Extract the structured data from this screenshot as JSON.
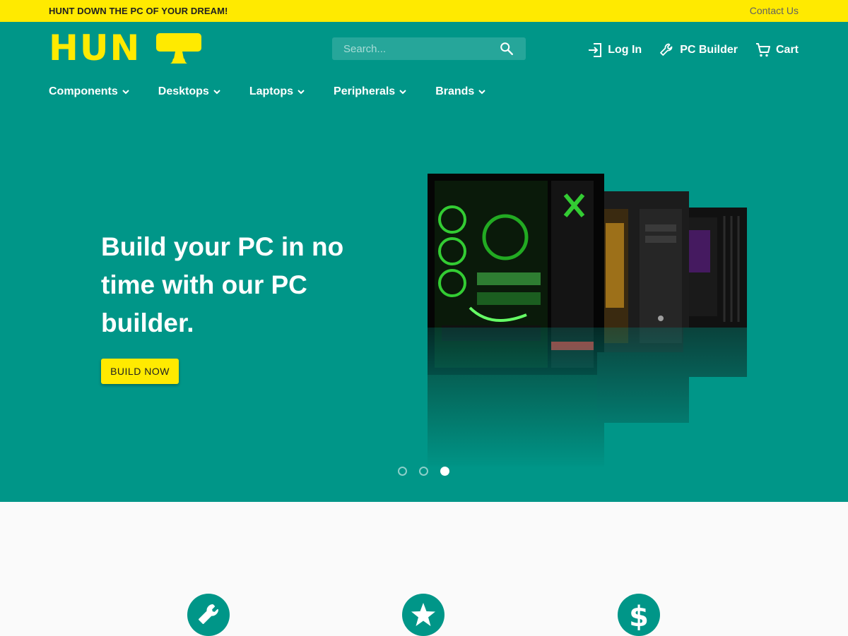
{
  "topbar": {
    "tagline": "HUNT DOWN THE PC OF YOUR DREAM!",
    "contact_label": "Contact Us"
  },
  "logo": {
    "text": "HUN"
  },
  "search": {
    "placeholder": "Search..."
  },
  "actions": {
    "login_label": "Log In",
    "pc_builder_label": "PC Builder",
    "cart_label": "Cart"
  },
  "nav": {
    "items": [
      {
        "label": "Components"
      },
      {
        "label": "Desktops"
      },
      {
        "label": "Laptops"
      },
      {
        "label": "Peripherals"
      },
      {
        "label": "Brands"
      }
    ]
  },
  "hero": {
    "title": "Build your PC in no time with our PC builder.",
    "button_label": "BUILD NOW"
  },
  "carousel": {
    "slide_count": 3,
    "active_slide": 3
  },
  "features": {
    "icons": [
      "wrench-icon",
      "star-icon",
      "dollar-icon"
    ]
  },
  "colors": {
    "primary": "#009688",
    "accent": "#ffea00",
    "search_bg": "#26a69a"
  }
}
